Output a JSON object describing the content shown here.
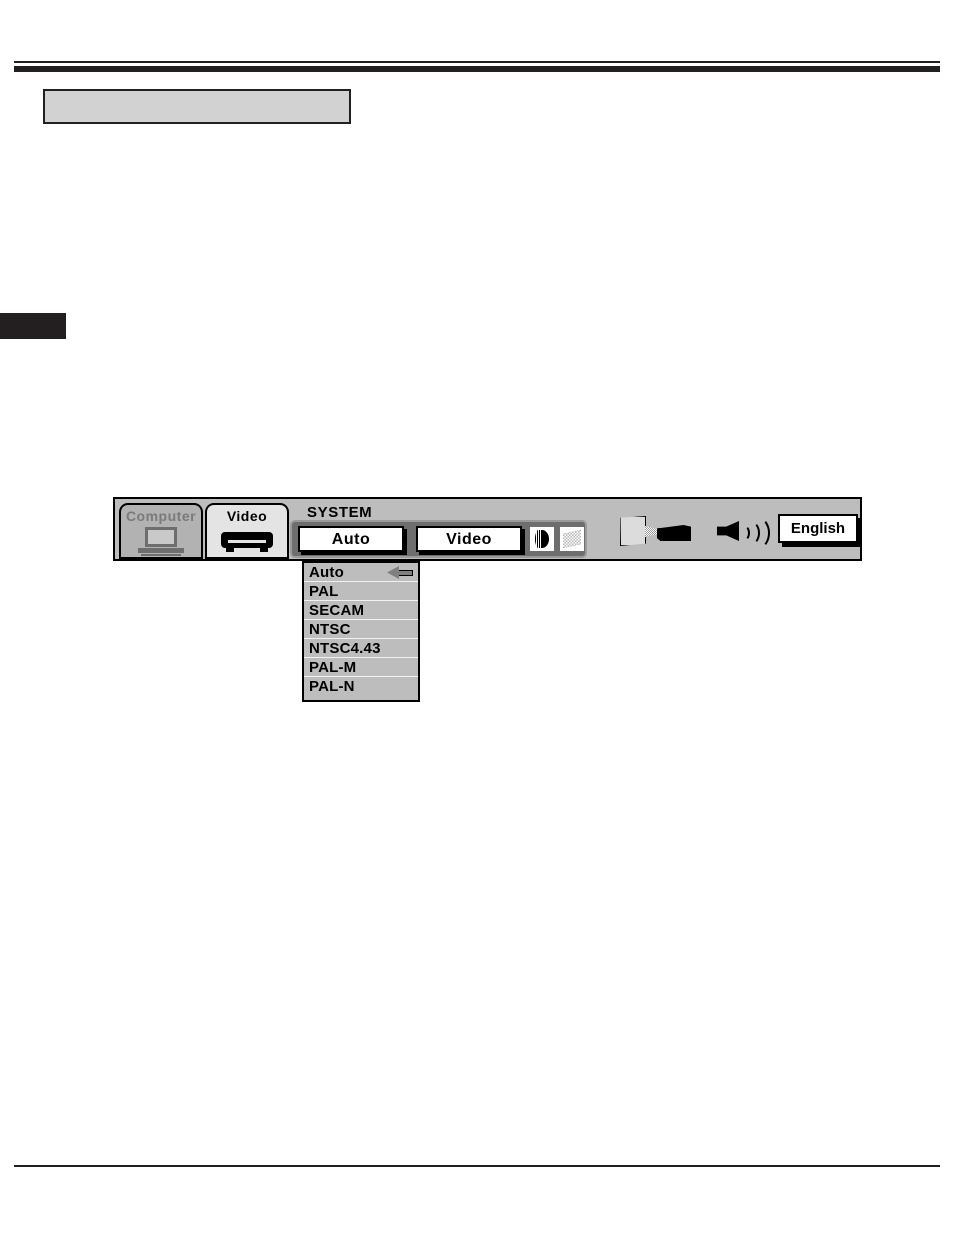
{
  "page": {
    "title_plate_text": "",
    "page_tab_label": ""
  },
  "osd": {
    "source_tabs": [
      {
        "label": "Computer",
        "icon": "laptop-icon",
        "state": "inactive"
      },
      {
        "label": "Video",
        "icon": "vcr-icon",
        "state": "active"
      }
    ],
    "system": {
      "group_label": "SYSTEM",
      "fields": [
        {
          "name": "system-auto",
          "value": "Auto"
        },
        {
          "name": "system-video",
          "value": "Video"
        }
      ],
      "icons": [
        {
          "name": "image-adjust-icon"
        },
        {
          "name": "screen-icon"
        }
      ]
    },
    "status_icons": [
      {
        "name": "projector-icon"
      },
      {
        "name": "volume-icon"
      }
    ],
    "language": {
      "value": "English"
    }
  },
  "dropdown": {
    "selected": "Auto",
    "pointer_icon": "left-arrow-icon",
    "items": [
      {
        "label": "Auto",
        "selected": true
      },
      {
        "label": "PAL",
        "selected": false
      },
      {
        "label": "SECAM",
        "selected": false
      },
      {
        "label": "NTSC",
        "selected": false
      },
      {
        "label": "NTSC4.43",
        "selected": false
      },
      {
        "label": "PAL-M",
        "selected": false
      },
      {
        "label": "PAL-N",
        "selected": false
      }
    ]
  },
  "colors": {
    "rule": "#231f20",
    "plate_fill": "#d2d2d2",
    "osd_bg": "#bdbdbd",
    "osd_group_bg": "#6e6e6e",
    "field_bg": "#ffffff",
    "tab_active_bg": "#e4e4e4",
    "tab_inactive_bg": "#b2b2b2",
    "tab_inactive_text": "#7a7a7a"
  }
}
